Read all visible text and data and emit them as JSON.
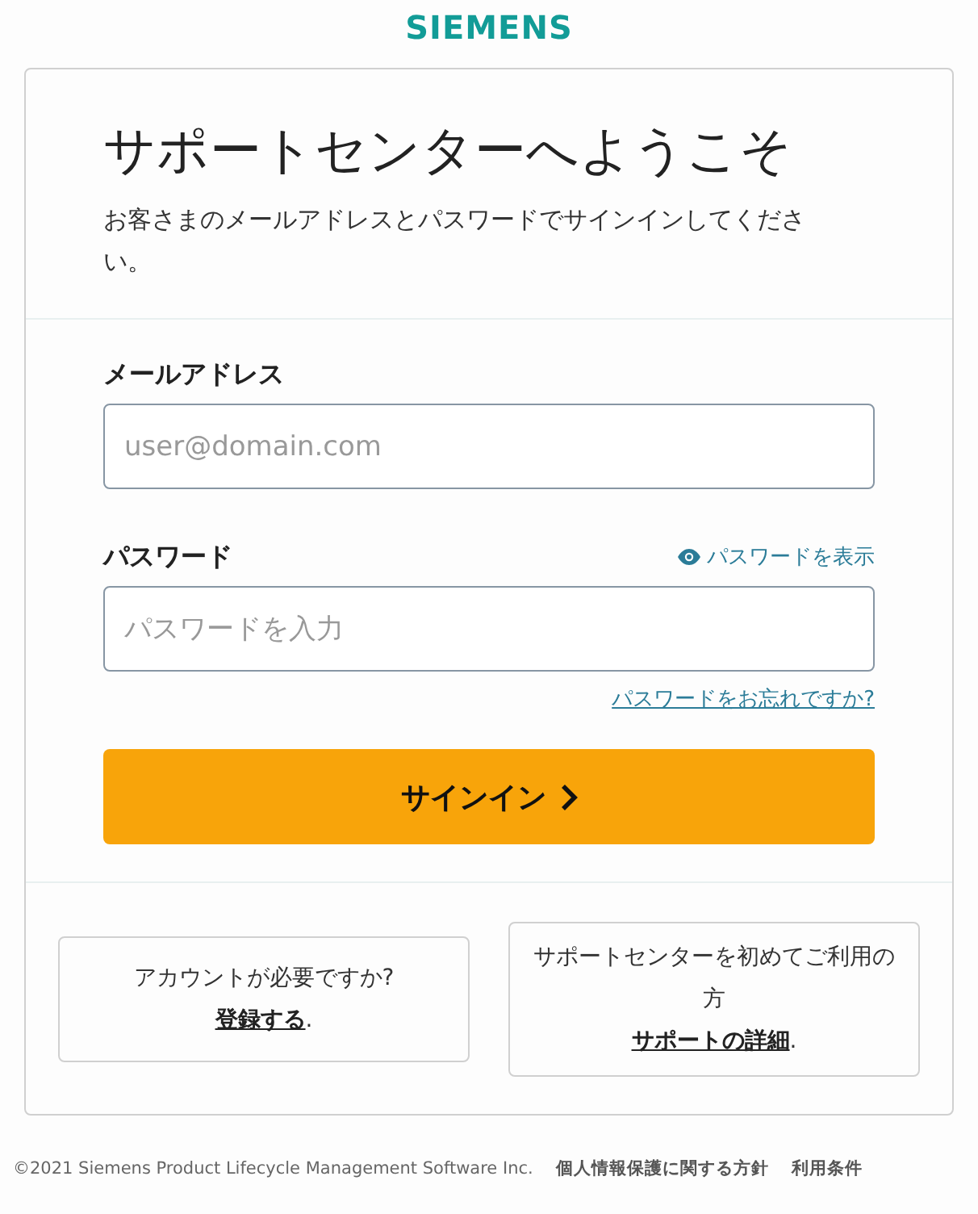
{
  "logo": "SIEMENS",
  "heading": "サポートセンターへようこそ",
  "intro": "お客さまのメールアドレスとパスワードでサインインしてください。",
  "fields": [
    {
      "label": "メールアドレス",
      "placeholder": "user@domain.com"
    },
    {
      "label": "パスワード",
      "placeholder": "パスワードを入力",
      "toggle": "パスワードを表示",
      "help_link": "パスワードをお忘れですか?"
    }
  ],
  "submit": "サインイン",
  "info_boxes": [
    {
      "text": "アカウントが必要ですか?",
      "link": "登録する",
      "after": "."
    },
    {
      "text": "サポートセンターを初めてご利用の方",
      "link": "サポートの詳細",
      "after": "."
    }
  ],
  "footer": {
    "copyright": "©2021 Siemens Product Lifecycle Management Software Inc.",
    "links": [
      "個人情報保護に関する方針",
      "利用条件"
    ]
  }
}
